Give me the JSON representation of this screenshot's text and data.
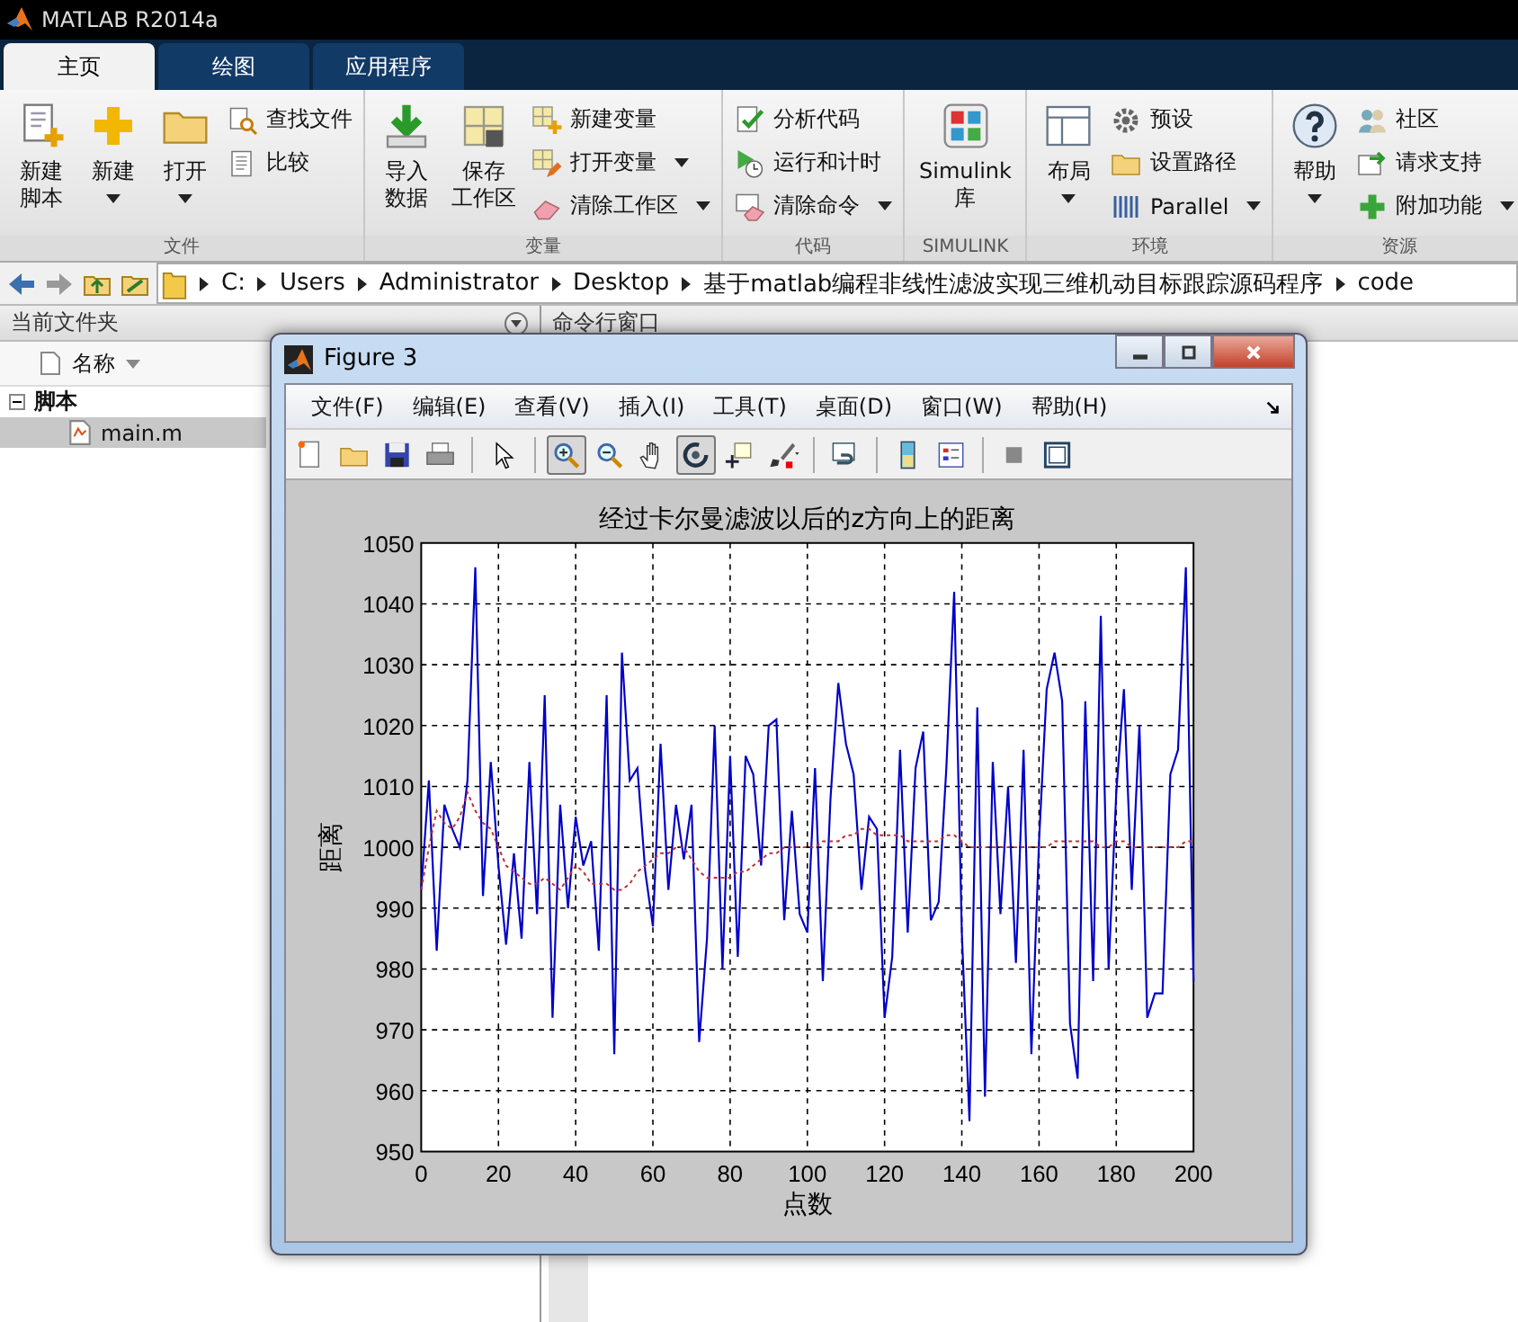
{
  "window": {
    "title": "MATLAB R2014a"
  },
  "tabs": [
    {
      "label": "主页",
      "selected": true
    },
    {
      "label": "绘图",
      "selected": false
    },
    {
      "label": "应用程序",
      "selected": false
    }
  ],
  "ribbon": {
    "groups": [
      {
        "label": "文件",
        "items": [
          {
            "kind": "big",
            "lines": [
              "新建",
              "脚本"
            ],
            "dropdown": false
          },
          {
            "kind": "big",
            "lines": [
              "新建"
            ],
            "dropdown": true
          },
          {
            "kind": "big",
            "lines": [
              "打开"
            ],
            "dropdown": true
          },
          {
            "kind": "small",
            "label": "查找文件",
            "dropdown": false
          },
          {
            "kind": "small",
            "label": "比较",
            "dropdown": false
          }
        ]
      },
      {
        "label": "变量",
        "items": [
          {
            "kind": "big",
            "lines": [
              "导入",
              "数据"
            ],
            "dropdown": false
          },
          {
            "kind": "big",
            "lines": [
              "保存",
              "工作区"
            ],
            "dropdown": false
          },
          {
            "kind": "small",
            "label": "新建变量",
            "dropdown": false
          },
          {
            "kind": "small",
            "label": "打开变量",
            "dropdown": true
          },
          {
            "kind": "small",
            "label": "清除工作区",
            "dropdown": true
          }
        ]
      },
      {
        "label": "代码",
        "items": [
          {
            "kind": "small",
            "label": "分析代码",
            "dropdown": false
          },
          {
            "kind": "small",
            "label": "运行和计时",
            "dropdown": false
          },
          {
            "kind": "small",
            "label": "清除命令",
            "dropdown": true
          }
        ]
      },
      {
        "label": "SIMULINK",
        "items": [
          {
            "kind": "big",
            "lines": [
              "Simulink",
              "库"
            ],
            "dropdown": false
          }
        ]
      },
      {
        "label": "环境",
        "items": [
          {
            "kind": "big",
            "lines": [
              "布局"
            ],
            "dropdown": true
          },
          {
            "kind": "small",
            "label": "预设",
            "dropdown": false
          },
          {
            "kind": "small",
            "label": "设置路径",
            "dropdown": false
          },
          {
            "kind": "small",
            "label": "Parallel",
            "dropdown": true
          }
        ]
      },
      {
        "label": "资源",
        "items": [
          {
            "kind": "big",
            "lines": [
              "帮助"
            ],
            "dropdown": true
          },
          {
            "kind": "small",
            "label": "社区",
            "dropdown": false
          },
          {
            "kind": "small",
            "label": "请求支持",
            "dropdown": false
          },
          {
            "kind": "small",
            "label": "附加功能",
            "dropdown": true
          }
        ]
      }
    ]
  },
  "address_bar": {
    "path": [
      "C:",
      "Users",
      "Administrator",
      "Desktop",
      "基于matlab编程非线性滤波实现三维机动目标跟踪源码程序",
      "code"
    ]
  },
  "current_folder": {
    "title": "当前文件夹",
    "column": "名称",
    "tree": [
      {
        "label": "脚本",
        "expanded": true,
        "selected": false,
        "children": [
          {
            "label": "main.m",
            "selected": true
          }
        ]
      }
    ]
  },
  "command_window": {
    "title": "命令行窗口"
  },
  "figure": {
    "title": "Figure 3",
    "menu": [
      "文件(F)",
      "编辑(E)",
      "查看(V)",
      "插入(I)",
      "工具(T)",
      "桌面(D)",
      "窗口(W)",
      "帮助(H)"
    ],
    "toolbar": [
      {
        "kind": "button",
        "selected": false
      },
      {
        "kind": "button",
        "selected": false
      },
      {
        "kind": "button",
        "selected": false
      },
      {
        "kind": "button",
        "selected": false
      },
      {
        "kind": "separator"
      },
      {
        "kind": "button",
        "selected": false
      },
      {
        "kind": "separator"
      },
      {
        "kind": "button",
        "selected": true
      },
      {
        "kind": "button",
        "selected": false
      },
      {
        "kind": "button",
        "selected": false
      },
      {
        "kind": "button",
        "selected": true
      },
      {
        "kind": "button",
        "selected": false
      },
      {
        "kind": "button",
        "selected": false
      },
      {
        "kind": "separator"
      },
      {
        "kind": "button",
        "selected": false
      },
      {
        "kind": "separator"
      },
      {
        "kind": "button",
        "selected": false
      },
      {
        "kind": "button",
        "selected": false
      },
      {
        "kind": "separator"
      },
      {
        "kind": "button",
        "selected": false
      },
      {
        "kind": "button",
        "selected": false
      }
    ],
    "chart_data": {
      "type": "line",
      "title": "经过卡尔曼滤波以后的z方向上的距离",
      "xlabel": "点数",
      "ylabel": "距离",
      "x": [
        0,
        2,
        4,
        6,
        8,
        10,
        12,
        14,
        16,
        18,
        20,
        22,
        24,
        26,
        28,
        30,
        32,
        34,
        36,
        38,
        40,
        42,
        44,
        46,
        48,
        50,
        52,
        54,
        56,
        58,
        60,
        62,
        64,
        66,
        68,
        70,
        72,
        74,
        76,
        78,
        80,
        82,
        84,
        86,
        88,
        90,
        92,
        94,
        96,
        98,
        100,
        102,
        104,
        106,
        108,
        110,
        112,
        114,
        116,
        118,
        120,
        122,
        124,
        126,
        128,
        130,
        132,
        134,
        136,
        138,
        140,
        142,
        144,
        146,
        148,
        150,
        152,
        154,
        156,
        158,
        160,
        162,
        164,
        166,
        168,
        170,
        172,
        174,
        176,
        178,
        180,
        182,
        184,
        186,
        188,
        190,
        192,
        194,
        196,
        198,
        200
      ],
      "series": [
        {
          "color": "#0000c8",
          "line_style": "solid",
          "values": [
            993,
            1011,
            983,
            1007,
            1003,
            1000,
            1011,
            1046,
            992,
            1014,
            997,
            984,
            999,
            985,
            1014,
            989,
            1025,
            972,
            1007,
            990,
            1005,
            997,
            1001,
            983,
            1025,
            966,
            1032,
            1011,
            1013,
            996,
            987,
            1017,
            993,
            1007,
            998,
            1007,
            968,
            985,
            1020,
            980,
            1015,
            982,
            1015,
            1012,
            997,
            1020,
            1021,
            988,
            1006,
            989,
            986,
            1013,
            978,
            1008,
            1027,
            1017,
            1012,
            993,
            1005,
            1003,
            972,
            982,
            1016,
            986,
            1013,
            1019,
            988,
            991,
            1013,
            1042,
            986,
            955,
            1023,
            959,
            1014,
            989,
            1010,
            981,
            1016,
            966,
            1001,
            1026,
            1032,
            1024,
            971,
            962,
            1024,
            978,
            1038,
            980,
            1009,
            1026,
            993,
            1020,
            972,
            976,
            976,
            1012,
            1016,
            1046,
            978
          ]
        },
        {
          "color": "#c03030",
          "line_style": "dashed",
          "values": [
            993,
            1000,
            1006,
            1004,
            1003,
            1005,
            1009,
            1006,
            1004,
            1003,
            1000,
            997,
            996,
            995,
            994,
            994,
            995,
            994,
            993,
            995,
            997,
            996,
            994,
            994,
            994,
            993,
            993,
            994,
            996,
            997,
            998,
            999,
            999,
            1000,
            1000,
            998,
            996,
            995,
            995,
            995,
            995,
            996,
            996,
            997,
            998,
            999,
            999,
            1000,
            1000,
            1000,
            1000,
            1000,
            1001,
            1001,
            1001,
            1002,
            1002,
            1003,
            1003,
            1002,
            1002,
            1002,
            1002,
            1001,
            1001,
            1001,
            1001,
            1001,
            1002,
            1002,
            1001,
            1000,
            1000,
            1000,
            1000,
            1000,
            1000,
            1000,
            1000,
            1000,
            1000,
            1000,
            1001,
            1001,
            1001,
            1001,
            1001,
            1001,
            1000,
            1000,
            1001,
            1001,
            1000,
            1000,
            1000,
            1000,
            1000,
            1000,
            1000,
            1001,
            1001
          ]
        }
      ],
      "grid": true,
      "xlim": [
        0,
        200
      ],
      "ylim": [
        950,
        1050
      ],
      "xticks": [
        0,
        20,
        40,
        60,
        80,
        100,
        120,
        140,
        160,
        180,
        200
      ],
      "yticks": [
        950,
        960,
        970,
        980,
        990,
        1000,
        1010,
        1020,
        1030,
        1040,
        1050
      ]
    }
  }
}
